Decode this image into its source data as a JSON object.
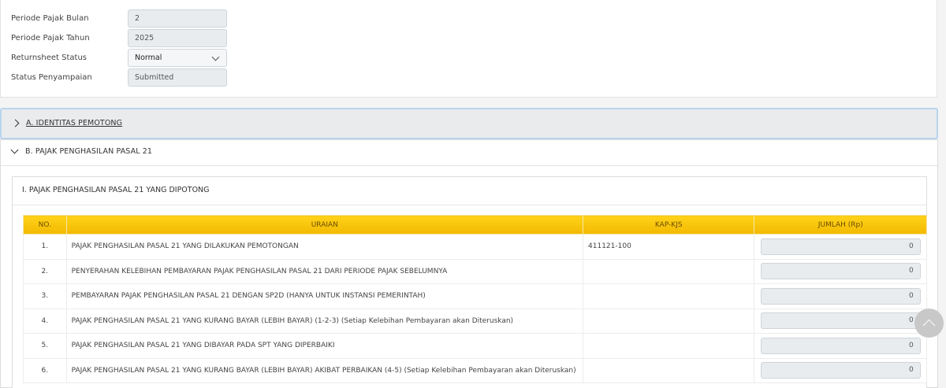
{
  "form": {
    "periode_bulan": {
      "label": "Periode Pajak Bulan",
      "value": "2"
    },
    "periode_tahun": {
      "label": "Periode Pajak Tahun",
      "value": "2025"
    },
    "returnsheet": {
      "label": "Returnsheet Status",
      "value": "Normal"
    },
    "status": {
      "label": "Status Penyampaian",
      "value": "Submitted"
    }
  },
  "sections": {
    "a_title": "A. IDENTITAS PEMOTONG",
    "b_title": "B. PAJAK PENGHASILAN PASAL 21",
    "sub_title": "I. PAJAK PENGHASILAN PASAL 21 YANG DIPOTONG"
  },
  "table": {
    "headers": {
      "no": "NO.",
      "uraian": "URAIAN",
      "kap": "KAP-KJS",
      "jumlah": "JUMLAH (Rp)"
    },
    "rows": [
      {
        "no": "1.",
        "uraian": "PAJAK PENGHASILAN PASAL 21 YANG DILAKUKAN PEMOTONGAN",
        "kap": "411121-100",
        "jumlah": "0"
      },
      {
        "no": "2.",
        "uraian": "PENYERAHAN KELEBIHAN PEMBAYARAN PAJAK PENGHASILAN PASAL 21 DARI PERIODE PAJAK SEBELUMNYA",
        "kap": "",
        "jumlah": "0"
      },
      {
        "no": "3.",
        "uraian": "PEMBAYARAN PAJAK PENGHASILAN PASAL 21 DENGAN SP2D (HANYA UNTUK INSTANSI PEMERINTAH)",
        "kap": "",
        "jumlah": "0"
      },
      {
        "no": "4.",
        "uraian": "PAJAK PENGHASILAN PASAL 21 YANG KURANG BAYAR (LEBIH BAYAR) (1-2-3) (Setiap Kelebihan Pembayaran akan Diteruskan)",
        "kap": "",
        "jumlah": "0"
      },
      {
        "no": "5.",
        "uraian": "PAJAK PENGHASILAN PASAL 21 YANG DIBAYAR PADA SPT YANG DIPERBAIKI",
        "kap": "",
        "jumlah": "0"
      },
      {
        "no": "6.",
        "uraian": "PAJAK PENGHASILAN PASAL 21 YANG KURANG BAYAR (LEBIH BAYAR) AKIBAT PERBAIKAN (4-5) (Setiap Kelebihan Pembayaran akan Diteruskan)",
        "kap": "",
        "jumlah": "0"
      }
    ]
  },
  "icons": {
    "accordion_a": "chevron-right-icon",
    "accordion_b": "chevron-down-icon",
    "select": "chevron-down-icon",
    "scroll_top": "chevron-up-icon"
  },
  "colors": {
    "header_gold": "#f2b900",
    "header_text": "#6b4d00",
    "accordion_focus": "#b9d4ee"
  }
}
